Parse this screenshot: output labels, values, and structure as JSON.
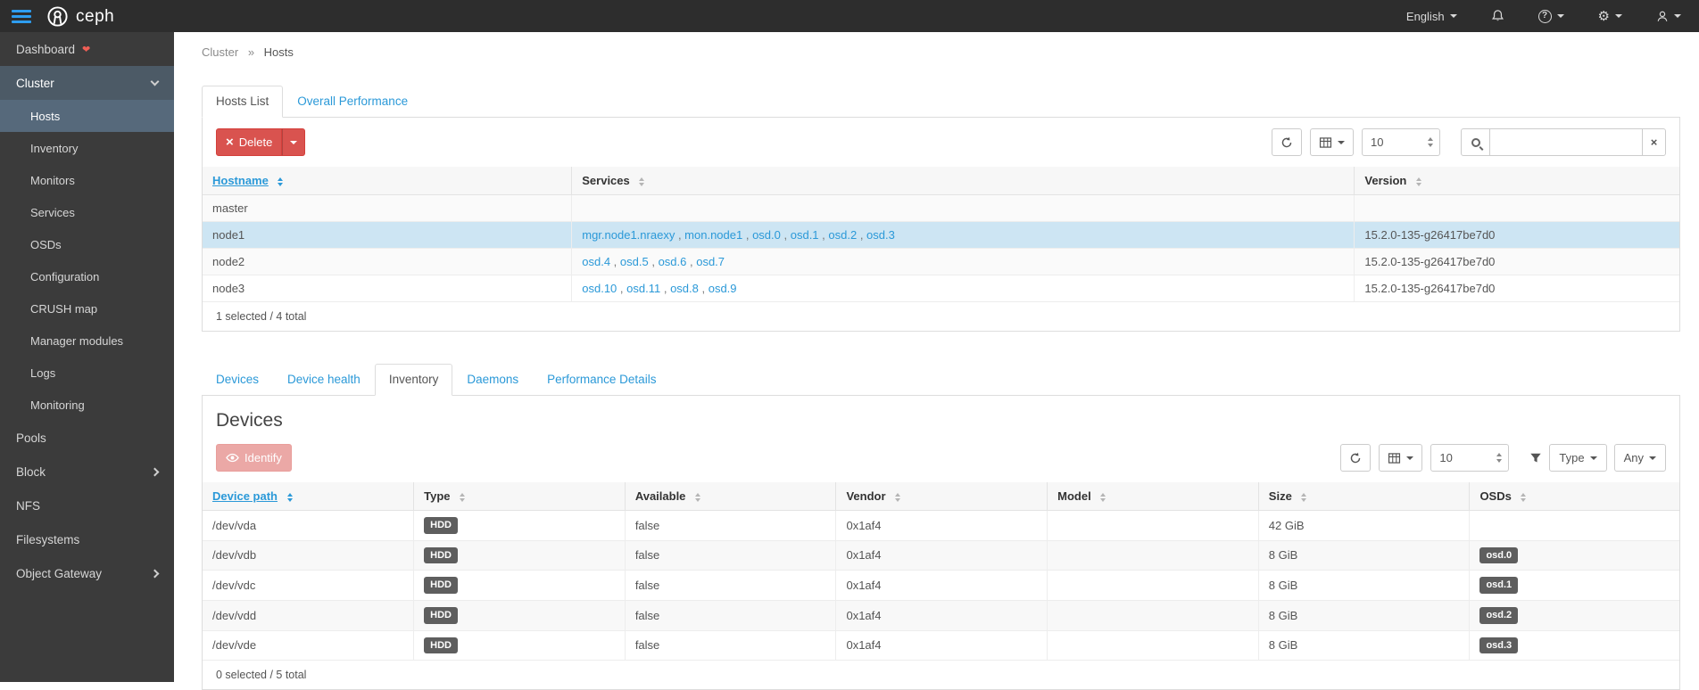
{
  "navbar": {
    "brand": "ceph",
    "language_menu_label": "English",
    "help_glyph": "?",
    "gear_glyph": "⚙"
  },
  "icons": {
    "times": "×",
    "heart": "❤"
  },
  "sidebar": {
    "items": [
      {
        "label": "Dashboard"
      },
      {
        "label": "Cluster",
        "expanded": true,
        "children": [
          {
            "label": "Hosts",
            "active": true
          },
          {
            "label": "Inventory"
          },
          {
            "label": "Monitors"
          },
          {
            "label": "Services"
          },
          {
            "label": "OSDs"
          },
          {
            "label": "Configuration"
          },
          {
            "label": "CRUSH map"
          },
          {
            "label": "Manager modules"
          },
          {
            "label": "Logs"
          },
          {
            "label": "Monitoring"
          }
        ]
      },
      {
        "label": "Pools"
      },
      {
        "label": "Block",
        "collapsible": true
      },
      {
        "label": "NFS"
      },
      {
        "label": "Filesystems"
      },
      {
        "label": "Object Gateway",
        "collapsible": true
      }
    ]
  },
  "breadcrumb": {
    "section": "Cluster",
    "separator": "»",
    "page": "Hosts"
  },
  "hosts_panel": {
    "tabs": [
      {
        "label": "Hosts List",
        "active": true
      },
      {
        "label": "Overall Performance"
      }
    ],
    "toolbar": {
      "delete_label": "Delete",
      "page_size": "10",
      "search_value": ""
    },
    "table": {
      "columns": [
        "Hostname",
        "Services",
        "Version"
      ],
      "sorted_column": "Hostname",
      "rows": [
        {
          "hostname": "master",
          "services": [],
          "version": ""
        },
        {
          "hostname": "node1",
          "selected": true,
          "services": [
            "mgr.node1.nraexy",
            "mon.node1",
            "osd.0",
            "osd.1",
            "osd.2",
            "osd.3"
          ],
          "version": "15.2.0-135-g26417be7d0"
        },
        {
          "hostname": "node2",
          "services": [
            "osd.4",
            "osd.5",
            "osd.6",
            "osd.7"
          ],
          "version": "15.2.0-135-g26417be7d0"
        },
        {
          "hostname": "node3",
          "services": [
            "osd.10",
            "osd.11",
            "osd.8",
            "osd.9"
          ],
          "version": "15.2.0-135-g26417be7d0"
        }
      ],
      "footer": "1 selected / 4 total"
    }
  },
  "details_panel": {
    "tabs": [
      {
        "label": "Devices"
      },
      {
        "label": "Device health"
      },
      {
        "label": "Inventory",
        "active": true
      },
      {
        "label": "Daemons"
      },
      {
        "label": "Performance Details"
      }
    ],
    "heading": "Devices",
    "toolbar": {
      "identify_label": "Identify",
      "page_size": "10",
      "type_filter_label": "Type",
      "type_filter_value": "Any"
    },
    "table": {
      "columns": [
        "Device path",
        "Type",
        "Available",
        "Vendor",
        "Model",
        "Size",
        "OSDs"
      ],
      "sorted_column": "Device path",
      "rows": [
        {
          "path": "/dev/vda",
          "type": "HDD",
          "available": "false",
          "vendor": "0x1af4",
          "model": "",
          "size": "42 GiB",
          "osds": []
        },
        {
          "path": "/dev/vdb",
          "type": "HDD",
          "available": "false",
          "vendor": "0x1af4",
          "model": "",
          "size": "8 GiB",
          "osds": [
            "osd.0"
          ]
        },
        {
          "path": "/dev/vdc",
          "type": "HDD",
          "available": "false",
          "vendor": "0x1af4",
          "model": "",
          "size": "8 GiB",
          "osds": [
            "osd.1"
          ]
        },
        {
          "path": "/dev/vdd",
          "type": "HDD",
          "available": "false",
          "vendor": "0x1af4",
          "model": "",
          "size": "8 GiB",
          "osds": [
            "osd.2"
          ]
        },
        {
          "path": "/dev/vde",
          "type": "HDD",
          "available": "false",
          "vendor": "0x1af4",
          "model": "",
          "size": "8 GiB",
          "osds": [
            "osd.3"
          ]
        }
      ],
      "footer": "0 selected / 5 total"
    }
  },
  "colors": {
    "accent_blue": "#2b99d8",
    "danger_red": "#d9534f",
    "selected_row_blue": "#cde5f3",
    "navbar_bg": "#2d2d2d",
    "sidebar_bg": "#3b3b3b",
    "badge_gray": "#5e5e5e"
  }
}
